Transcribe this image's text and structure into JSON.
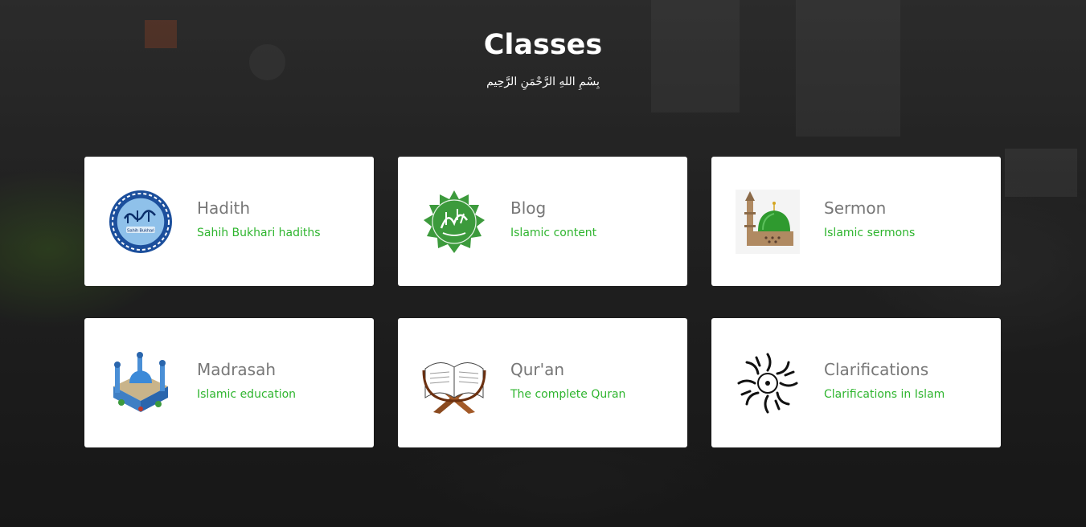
{
  "header": {
    "title": "Classes",
    "subtitle": "بِسْمِ اللهِ الرَّحْمَنِ الرَّحِيم"
  },
  "colors": {
    "card_title": "#777777",
    "card_desc": "#2fb52f",
    "card_bg": "#ffffff",
    "heading": "#ffffff"
  },
  "cards": [
    {
      "title": "Hadith",
      "desc": "Sahih Bukhari hadiths",
      "icon": "sahih-bukhari-emblem-icon"
    },
    {
      "title": "Blog",
      "desc": "Islamic content",
      "icon": "quran-calligraphy-seal-icon"
    },
    {
      "title": "Sermon",
      "desc": "Islamic sermons",
      "icon": "mosque-green-dome-icon"
    },
    {
      "title": "Madrasah",
      "desc": "Islamic education",
      "icon": "madrasah-building-icon"
    },
    {
      "title": "Qur'an",
      "desc": "The complete Quran",
      "icon": "open-quran-on-stand-icon"
    },
    {
      "title": "Clarifications",
      "desc": "Clarifications in Islam",
      "icon": "circular-calligraphy-icon"
    }
  ]
}
